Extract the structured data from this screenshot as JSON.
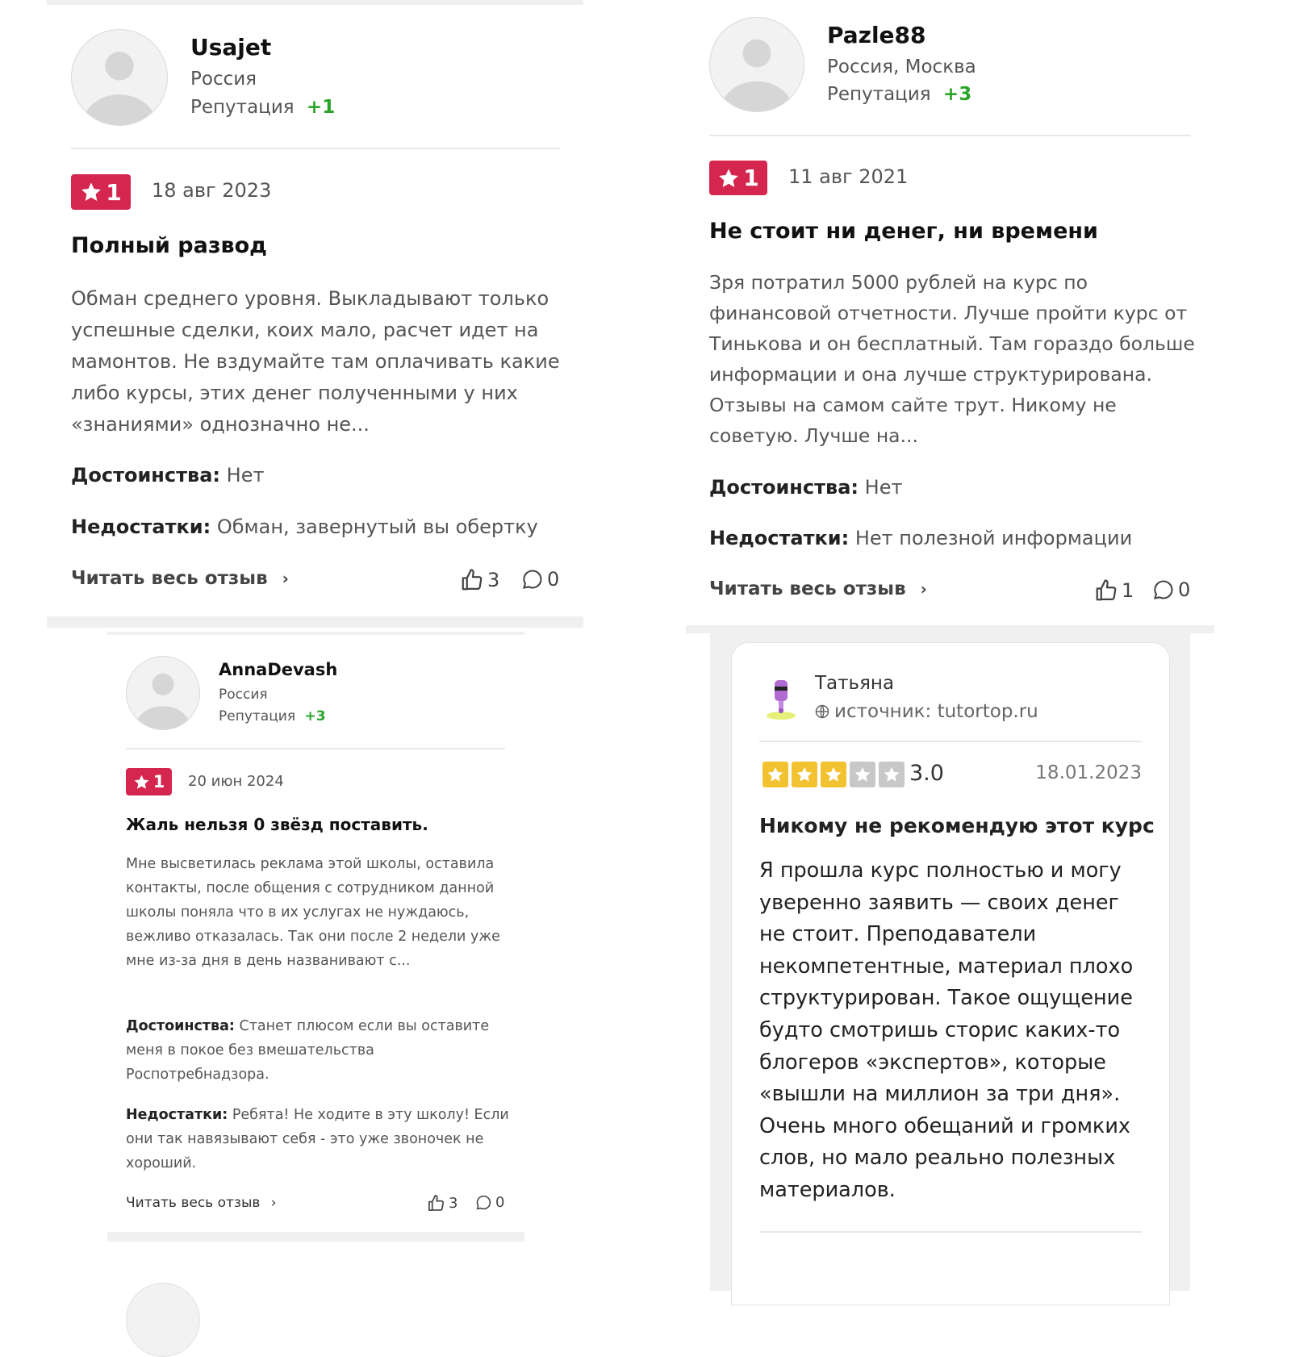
{
  "review1": {
    "name": "Usajet",
    "location": "Россия",
    "rep_label": "Репутация",
    "rep_value": "+1",
    "rating": "1",
    "date": "18 авг 2023",
    "title": "Полный развод",
    "text": "Обман среднего уровня. Выкладывают только успешные сделки, коих мало, расчет идет на мамонтов. Не вздумайте там оплачивать какие либо курсы, этих денег полученными у них «знаниями» однозначно не...",
    "pros_label": "Достоинства:",
    "pros": "Нет",
    "cons_label": "Недостатки:",
    "cons": "Обман, завернутый вы обертку",
    "read_more": "Читать весь отзыв",
    "likes": "3",
    "comments": "0"
  },
  "review2": {
    "name": "Pazle88",
    "location": "Россия, Москва",
    "rep_label": "Репутация",
    "rep_value": "+3",
    "rating": "1",
    "date": "11 авг 2021",
    "title": "Не стоит ни денег, ни времени",
    "text": "Зря потратил 5000 рублей на курс по финансовой отчетности. Лучше пройти курс от Тинькова и он бесплатный. Там гораздо больше информации и она лучше структурирована. Отзывы на самом сайте трут. Никому не советую. Лучше на...",
    "pros_label": "Достоинства:",
    "pros": "Нет",
    "cons_label": "Недостатки:",
    "cons": "Нет полезной информации",
    "read_more": "Читать весь отзыв",
    "likes": "1",
    "comments": "0"
  },
  "review3": {
    "name": "AnnaDevash",
    "location": "Россия",
    "rep_label": "Репутация",
    "rep_value": "+3",
    "rating": "1",
    "date": "20 июн 2024",
    "title": "Жаль нельзя 0 звёзд поставить.",
    "text": "Мне высветилась реклама этой школы, оставила контакты, после общения с сотрудником данной школы поняла что в их услугах не нуждаюсь, вежливо отказалась. Так они после 2 недели уже мне из-за дня в день названивают с...",
    "pros_label": "Достоинства:",
    "pros": "Станет плюсом если вы оставите меня в покое без вмешательства Роспотребнадзора.",
    "cons_label": "Недостатки:",
    "cons": "Ребята! Не ходите в эту школу! Если они так навязывают себя - это уже звоночек не хороший.",
    "read_more": "Читать весь отзыв",
    "likes": "3",
    "comments": "0"
  },
  "review4": {
    "name": "Татьяна",
    "source": "источник: tutortop.ru",
    "rating": 3,
    "rating_text": "3.0",
    "date": "18.01.2023",
    "title": "Никому не рекомендую этот курс",
    "text": "Я прошла курс полностью и могу уверенно заявить — своих денег не стоит. Преподаватели некомпетентные, материал плохо структурирован. Такое ощущение будто смотришь сторис каких-то блогеров «экспертов», которые «вышли на миллион за три дня». Очень много обещаний и громких слов, но мало реально полезных материалов."
  },
  "colors": {
    "badge": "#d4264e",
    "reputation": "#2aa52a",
    "star_filled": "#f2c230",
    "star_empty": "#c8c8c8"
  },
  "icons": [
    "user-avatar-icon",
    "star-icon",
    "thumbs-up-icon",
    "comment-icon",
    "chevron-right-icon",
    "globe-icon"
  ]
}
